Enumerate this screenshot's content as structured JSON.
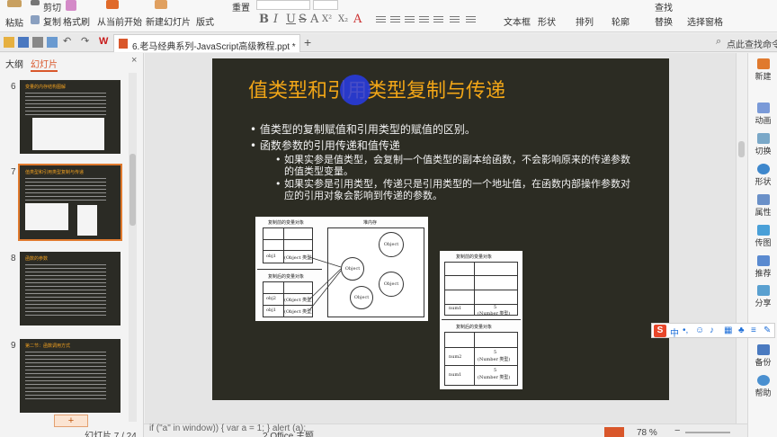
{
  "ribbon": {
    "paste": "粘贴",
    "cut": "剪切",
    "copy": "复制",
    "format_painter": "格式刷",
    "from_current": "从当前开始",
    "new_slide": "新建幻灯片",
    "layout": "版式",
    "reset": "重置",
    "font_buttons": [
      "B",
      "I",
      "U",
      "S",
      "A",
      "X²",
      "X₂",
      "A"
    ],
    "textbox": "文本框",
    "shape": "形状",
    "arrange": "排列",
    "outline": "轮廓",
    "find": "查找",
    "replace": "替换",
    "select_pane": "选择窗格"
  },
  "tabbar": {
    "doc_title": "6.老马经典系列-JavaScript高级教程.ppt *",
    "right_label": "点此查找命令"
  },
  "left_panel": {
    "tab_outline": "大纲",
    "tab_slides": "幻灯片",
    "add_label": "+",
    "slides": [
      {
        "num": "6",
        "title": "变量的内存结构图解"
      },
      {
        "num": "7",
        "title": "值类型和引用类型复制与传递"
      },
      {
        "num": "8",
        "title": "函数的参数"
      },
      {
        "num": "9",
        "title": "第二节：函数调用方式"
      }
    ]
  },
  "slide": {
    "title": "值类型和引用类型复制与传递",
    "bullets": [
      {
        "level": 1,
        "text": "值类型的复制赋值和引用类型的赋值的区别。"
      },
      {
        "level": 1,
        "text": "函数参数的引用传递和值传递"
      },
      {
        "level": 2,
        "text": "如果实参是值类型，会复制一个值类型的副本给函数，不会影响原来的传递参数"
      },
      {
        "level": 2,
        "text": "的值类型变量。"
      },
      {
        "level": 2,
        "text": "如果实参是引用类型，传递只是引用类型的一个地址值，在函数内部操作参数对"
      },
      {
        "level": 2,
        "text": "应的引用对象会影响到传递的参数。"
      }
    ],
    "diagram1": {
      "before_caption": "复制前的变量对象",
      "after_caption": "复制后的变量对象",
      "heap_caption": "堆内存",
      "obj1_name": "obj1",
      "obj1_value": "(Object 类型)",
      "obj2_name": "obj2",
      "obj2_value": "(Object 类型)",
      "obj1b_name": "obj1",
      "obj1b_value": "(Object 类型)",
      "object_label": "Object"
    },
    "diagram2": {
      "before_caption": "复制前的变量对象",
      "after_caption": "复制后的变量对象",
      "num1_name": "num1",
      "num_value": "5",
      "num_type": "(Number 类型)",
      "num2_name": "num2"
    }
  },
  "right_bar": {
    "items": [
      "新建",
      "动画",
      "切换",
      "形状",
      "属性",
      "传图",
      "推荐",
      "分享",
      "备份",
      "帮助"
    ]
  },
  "ime": {
    "logo": "S",
    "lang": "中"
  },
  "status": {
    "code_text": "if (\"a\" in window)) { var a = 1; } alert (a);",
    "slide_count": "幻灯片 7 / 24",
    "theme": "2 Office 主题",
    "zoom": "78 %"
  },
  "colors": {
    "slide_bg": "#2c2c23",
    "title": "#f2a617",
    "accent": "#e07a2e",
    "ime_red": "#e8462a"
  }
}
